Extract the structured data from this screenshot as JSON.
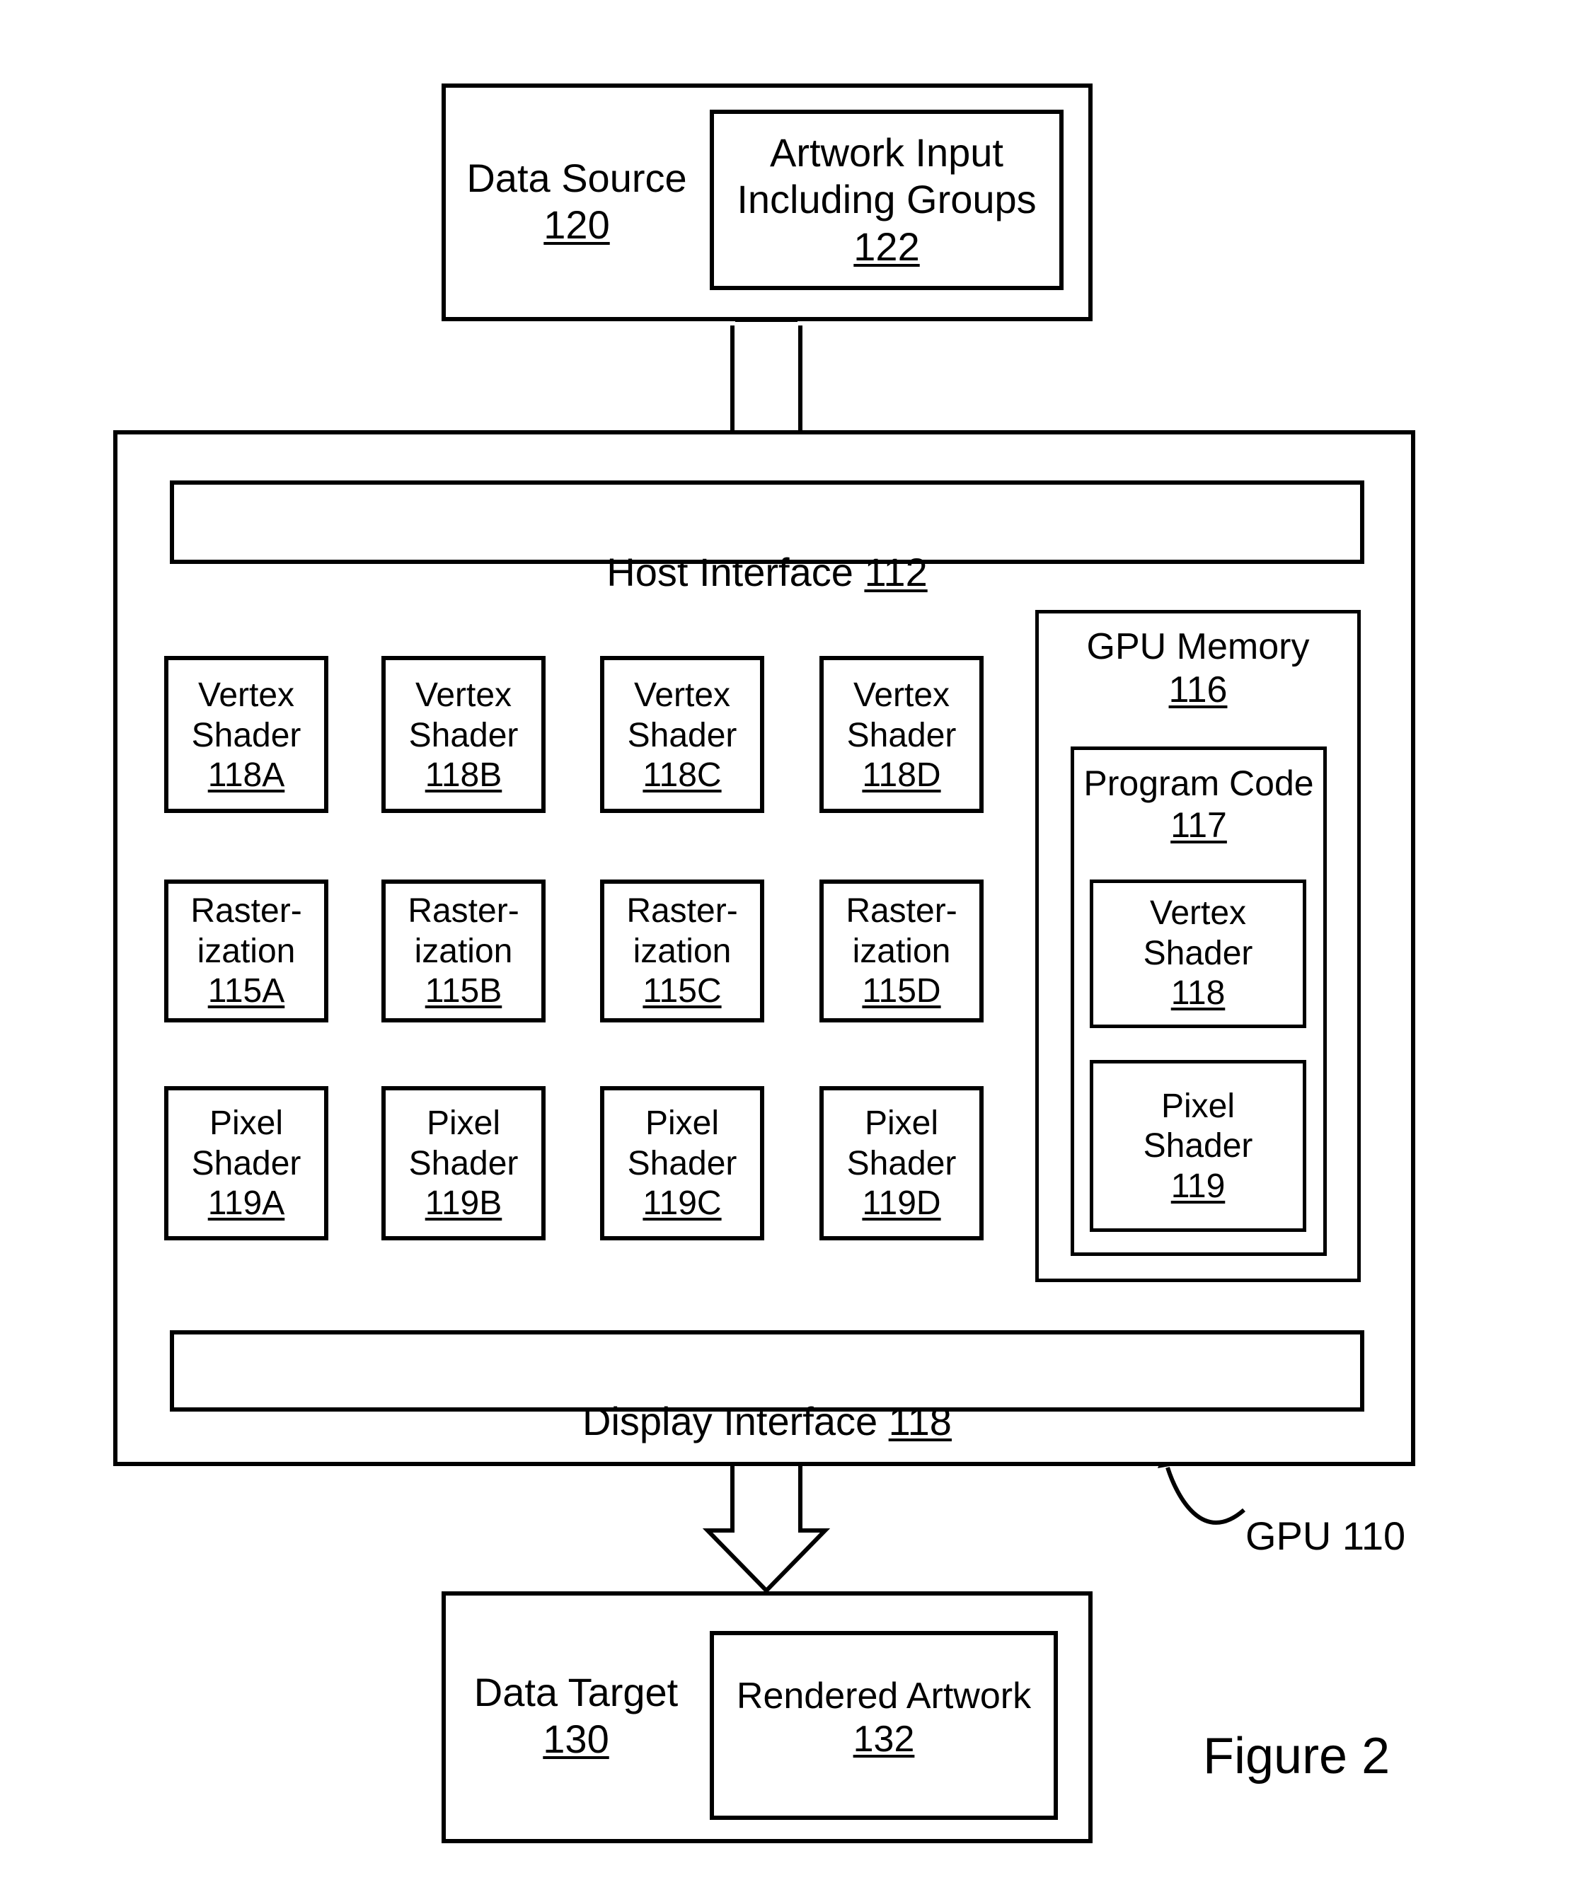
{
  "figure": {
    "caption": "Figure 2"
  },
  "data_source": {
    "label": "Data Source",
    "ref": "120",
    "artwork_input": {
      "label": "Artwork Input\nIncluding Groups",
      "ref": "122"
    }
  },
  "gpu": {
    "callout_label": "GPU 110",
    "host_interface": {
      "label": "Host Interface",
      "ref": "112"
    },
    "display_interface": {
      "label": "Display Interface",
      "ref": "118"
    },
    "pipelines": [
      {
        "vertex_shader": {
          "label": "Vertex\nShader",
          "ref": "118A"
        },
        "rasterization": {
          "label": "Raster-\nization",
          "ref": "115A"
        },
        "pixel_shader": {
          "label": "Pixel\nShader",
          "ref": "119A"
        }
      },
      {
        "vertex_shader": {
          "label": "Vertex\nShader",
          "ref": "118B"
        },
        "rasterization": {
          "label": "Raster-\nization",
          "ref": "115B"
        },
        "pixel_shader": {
          "label": "Pixel\nShader",
          "ref": "119B"
        }
      },
      {
        "vertex_shader": {
          "label": "Vertex\nShader",
          "ref": "118C"
        },
        "rasterization": {
          "label": "Raster-\nization",
          "ref": "115C"
        },
        "pixel_shader": {
          "label": "Pixel\nShader",
          "ref": "119C"
        }
      },
      {
        "vertex_shader": {
          "label": "Vertex\nShader",
          "ref": "118D"
        },
        "rasterization": {
          "label": "Raster-\nization",
          "ref": "115D"
        },
        "pixel_shader": {
          "label": "Pixel\nShader",
          "ref": "119D"
        }
      }
    ],
    "memory": {
      "label": "GPU Memory",
      "ref": "116",
      "program_code": {
        "label": "Program Code",
        "ref": "117",
        "vertex_shader": {
          "label": "Vertex\nShader",
          "ref": "118"
        },
        "pixel_shader": {
          "label": "Pixel\nShader",
          "ref": "119"
        }
      }
    }
  },
  "data_target": {
    "label": "Data Target",
    "ref": "130",
    "rendered_artwork": {
      "label": "Rendered Artwork",
      "ref": "132"
    }
  },
  "colors": {
    "stroke": "#000000",
    "background": "#ffffff"
  }
}
